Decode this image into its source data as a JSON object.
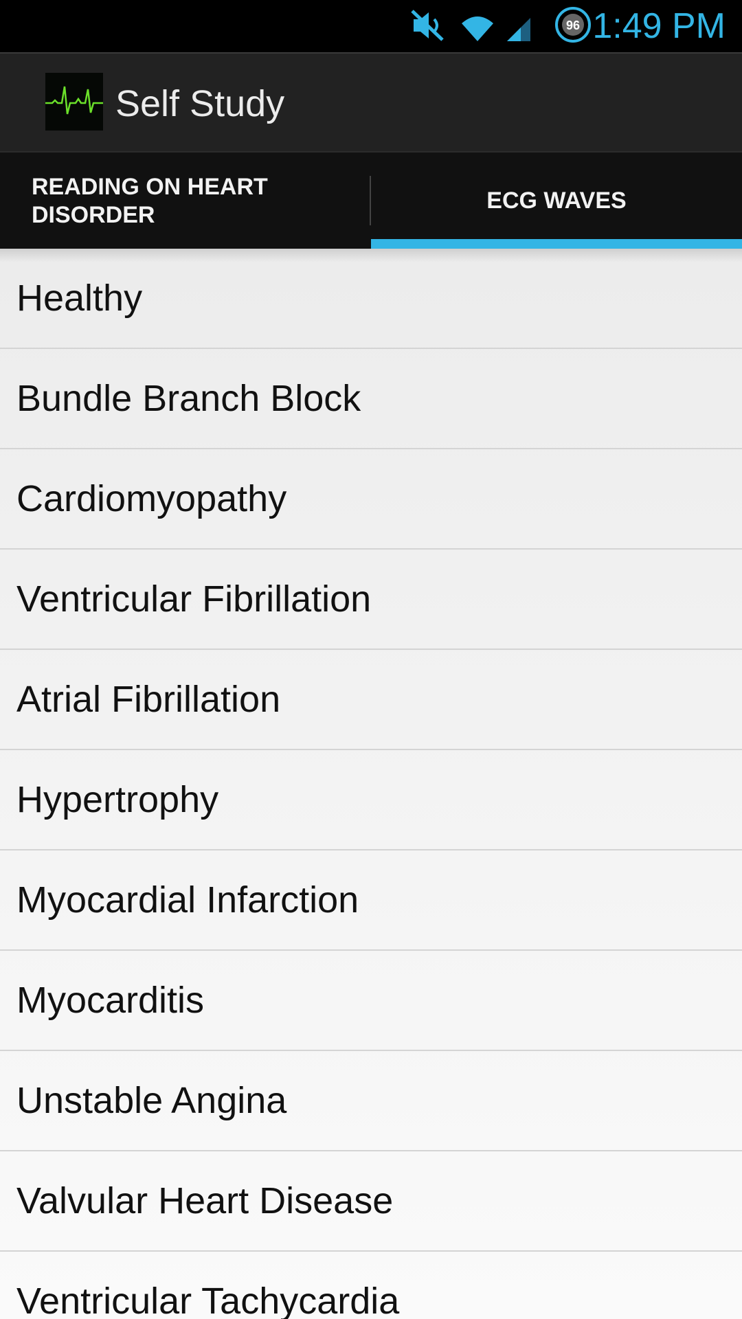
{
  "status_bar": {
    "time": "1:49 PM",
    "battery_level": "96",
    "icons": [
      "muted-icon",
      "wifi-icon",
      "signal-icon",
      "battery-icon"
    ]
  },
  "action_bar": {
    "title": "Self Study",
    "app_icon": "ecg-app-icon"
  },
  "tabs": [
    {
      "label": "READING ON HEART DISORDER",
      "selected": false
    },
    {
      "label": "ECG WAVES",
      "selected": true
    }
  ],
  "list_items": [
    "Healthy",
    "Bundle Branch Block",
    "Cardiomyopathy",
    "Ventricular Fibrillation",
    "Atrial Fibrillation",
    "Hypertrophy",
    "Myocardial Infarction",
    "Myocarditis",
    "Unstable Angina",
    "Valvular Heart Disease",
    "Ventricular Tachycardia"
  ],
  "colors": {
    "accent": "#33b5e5",
    "status_bar_bg": "#000000",
    "action_bar_bg": "#222222",
    "tab_bar_bg": "#111111"
  }
}
